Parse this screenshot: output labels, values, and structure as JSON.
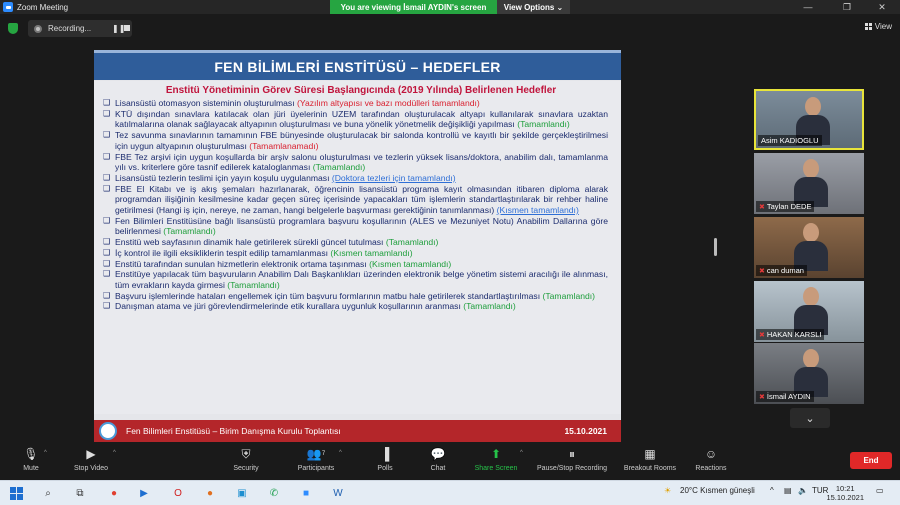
{
  "window": {
    "title": "Zoom Meeting",
    "viewing_banner": "You are viewing İsmail AYDIN's screen",
    "view_options": "View Options"
  },
  "recording": {
    "label": "Recording..."
  },
  "view_button": {
    "label": "View"
  },
  "slide": {
    "title": "FEN BİLİMLERİ ENSTİTÜSÜ – HEDEFLER",
    "subtitle": "Enstitü Yönetiminin Görev Süresi Başlangıcında (2019 Yılında) Belirlenen Hedefler",
    "items": [
      {
        "text": "Lisansüstü otomasyon sisteminin oluşturulması ",
        "status": "(Yazılım altyapısı ve bazı modülleri tamamlandı)",
        "status_class": "st-red"
      },
      {
        "text": "KTÜ dışından sınavlara katılacak olan jüri üyelerinin UZEM tarafından oluşturulacak altyapı kullanılarak sınavlara uzaktan katılmalarına olanak sağlayacak altyapının oluşturulması ve buna yönelik yönetmelik değişikliği yapılması ",
        "status": "(Tamamlandı)",
        "status_class": "st"
      },
      {
        "text": "Tez savunma sınavlarının tamamının FBE bünyesinde oluşturulacak bir salonda kontrollü ve kayıtlı bir şekilde gerçekleştirilmesi için uygun altyapının oluşturulması ",
        "status": "(Tamamlanamadı)",
        "status_class": "st-red"
      },
      {
        "text": "FBE Tez arşivi için uygun koşullarda bir arşiv salonu oluşturulması ve tezlerin yüksek lisans/doktora, anabilim dalı, tamamlanma yılı vs. kriterlere göre tasnif edilerek kataloglanması ",
        "status": "(Tamamlandı)",
        "status_class": "st"
      },
      {
        "text": "Lisansüstü tezlerin teslimi için yayın koşulu uygulanması ",
        "status": "(Doktora tezleri için tamamlandı)",
        "status_class": "st-blue"
      },
      {
        "text": "FBE El Kitabı ve iş akış şemaları hazırlanarak, öğrencinin lisansüstü programa kayıt olmasından itibaren diploma alarak programdan ilişiğinin kesilmesine kadar geçen süreç içerisinde yapacakları tüm işlemlerin standartlaştırılarak bir rehber haline getirilmesi (Hangi iş için, nereye, ne zaman, hangi belgelerle başvurması gerektiğinin tanımlanması) ",
        "status": "(Kısmen tamamlandı)",
        "status_class": "st-blue"
      },
      {
        "text": "Fen Bilimleri Enstitüsüne bağlı lisansüstü programlara başvuru koşullarının (ALES ve Mezuniyet Notu) Anabilim Dallarına göre belirlenmesi ",
        "status": "(Tamamlandı)",
        "status_class": "st"
      },
      {
        "text": "Enstitü web sayfasının dinamik hale getirilerek sürekli güncel tutulması ",
        "status": "(Tamamlandı)",
        "status_class": "st"
      },
      {
        "text": "İç kontrol ile ilgili eksikliklerin tespit edilip tamamlanması ",
        "status": "(Kısmen tamamlandı)",
        "status_class": "st"
      },
      {
        "text": "Enstitü tarafından sunulan hizmetlerin elektronik ortama taşınması ",
        "status": "(Kısmen tamamlandı)",
        "status_class": "st"
      },
      {
        "text": "Enstitüye yapılacak tüm başvuruların Anabilim Dalı Başkanlıkları üzerinden elektronik belge yönetim sistemi aracılığı ile alınması, tüm evrakların kayda girmesi ",
        "status": "(Tamamlandı)",
        "status_class": "st"
      },
      {
        "text": "Başvuru işlemlerinde hataları engellemek için tüm başvuru formlarının matbu hale getirilerek standartlaştırılması ",
        "status": "(Tamamlandı)",
        "status_class": "st"
      },
      {
        "text": "Danışman atama ve jüri görevlendirmelerinde etik kurallara uygunluk koşullarının aranması ",
        "status": "(Tamamlandı)",
        "status_class": "st"
      }
    ],
    "footer": "Fen Bilimleri Enstitüsü – Birim Danışma Kurulu Toplantısı",
    "footer_date": "15.10.2021"
  },
  "participants_tiles": [
    {
      "name": "Asim KADIOGLU",
      "muted": false,
      "active": true
    },
    {
      "name": "Taylan DEDE",
      "muted": true,
      "active": false
    },
    {
      "name": "can duman",
      "muted": true,
      "active": false
    },
    {
      "name": "HAKAN KARSLI",
      "muted": true,
      "active": false
    },
    {
      "name": "İsmail AYDIN",
      "muted": true,
      "active": false
    }
  ],
  "toolbar": {
    "mute": "Mute",
    "stop_video": "Stop Video",
    "security": "Security",
    "participants": "Participants",
    "participants_count": "7",
    "polls": "Polls",
    "chat": "Chat",
    "share_screen": "Share Screen",
    "recording": "Pause/Stop Recording",
    "breakout": "Breakout Rooms",
    "reactions": "Reactions",
    "end": "End"
  },
  "taskbar": {
    "weather": "20°C  Kısmen güneşli",
    "language": "TUR",
    "time": "10:21",
    "date": "15.10.2021"
  },
  "colors": {
    "zoom_blue": "#2d8cff",
    "banner_green": "#26a541",
    "end_red": "#e02828",
    "slide_header": "#2f5d9a",
    "slide_footer": "#b4262a"
  }
}
